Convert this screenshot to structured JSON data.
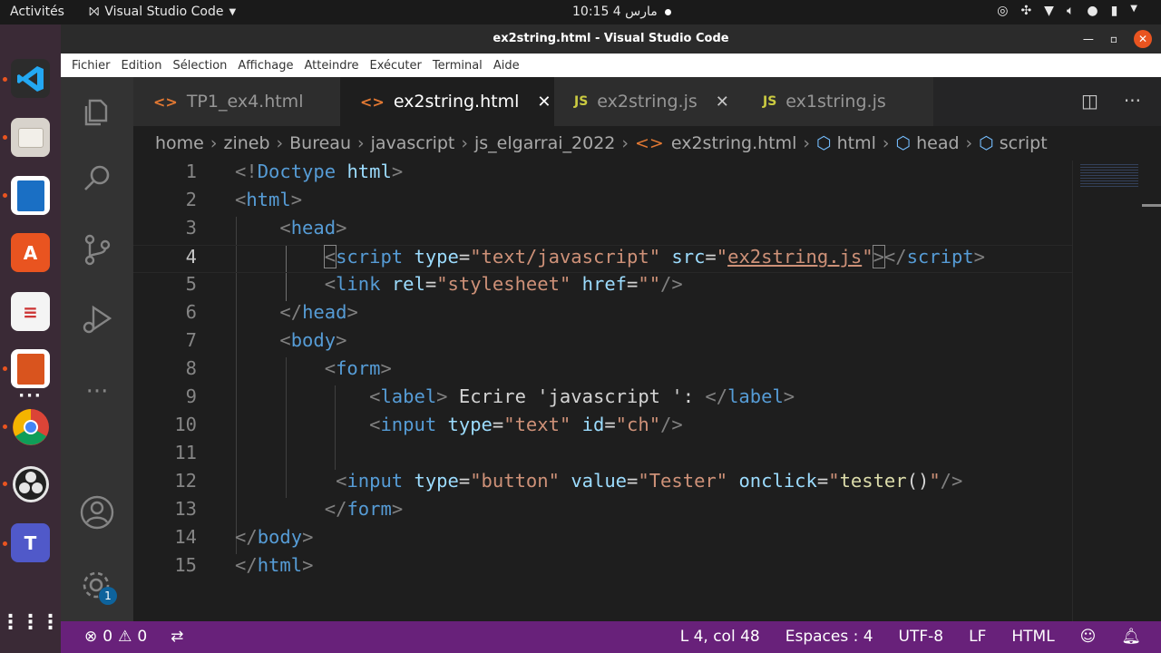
{
  "system": {
    "activities": "Activités",
    "app_name": "Visual Studio Code",
    "clock": "10:15  مارس 4"
  },
  "window": {
    "title": "ex2string.html - Visual Studio Code"
  },
  "menu": [
    "Fichier",
    "Edition",
    "Sélection",
    "Affichage",
    "Atteindre",
    "Exécuter",
    "Terminal",
    "Aide"
  ],
  "tabs": [
    {
      "label": "TP1_ex4.html",
      "icon": "html-file-icon"
    },
    {
      "label": "ex2string.html",
      "icon": "html-file-icon",
      "active": true
    },
    {
      "label": "ex2string.js",
      "icon": "js-file-icon"
    },
    {
      "label": "ex1string.js",
      "icon": "js-file-icon"
    }
  ],
  "breadcrumb": [
    "home",
    "zineb",
    "Bureau",
    "javascript",
    "js_elgarrai_2022",
    "ex2string.html",
    "html",
    "head",
    "script"
  ],
  "editor": {
    "current_line": 4,
    "line_numbers": [
      "1",
      "2",
      "3",
      "4",
      "5",
      "6",
      "7",
      "8",
      "9",
      "10",
      "11",
      "12",
      "13",
      "14",
      "15"
    ]
  },
  "status": {
    "errors": "0",
    "warnings": "0",
    "position": "L 4, col 48",
    "indent": "Espaces : 4",
    "encoding": "UTF-8",
    "eol": "LF",
    "language": "HTML"
  },
  "dock": {
    "settings_badge": "1"
  },
  "colors": {
    "status_bar": "#68217a",
    "tag": "#569cd6",
    "attribute": "#9cdcfe",
    "string": "#ce9178"
  }
}
